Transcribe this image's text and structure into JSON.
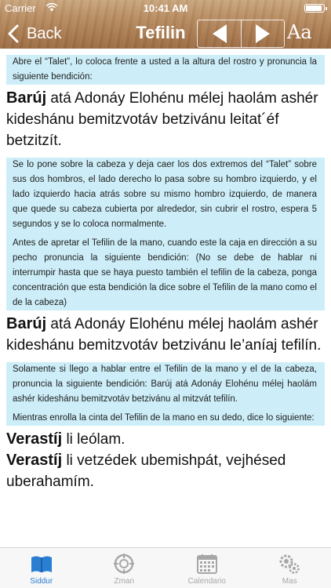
{
  "status": {
    "carrier": "Carrier",
    "time": "10:41 AM"
  },
  "nav": {
    "back_label": "Back",
    "title": "Tefilin",
    "font_button": "Aa"
  },
  "content": {
    "para1": "Abre el “Talet”, lo coloca frente a usted a la altura del rostro y pronuncia la siguiente bendición:",
    "prayer1_first": "Barúj",
    "prayer1_rest": " atá Adonáy Elohénu mélej haolám ashér kideshánu bemitzvotáv betzivánu leitat´éf betzitzít.",
    "para2": "Se lo pone sobre la cabeza y deja caer los dos extremos del “Talet” sobre sus dos hombros, el lado derecho lo pasa sobre su hombro izquierdo, y el lado izquierdo hacia atrás sobre su mismo hombro izquierdo, de manera que quede su cabeza cubierta por alrededor, sin cubrir el rostro, espera 5 segundos y se lo coloca normalmente.",
    "para3": "Antes de apretar el Tefilin de la mano, cuando este la caja en dirección a su pecho pronuncia la siguiente bendición: (No se debe de hablar ni interrumpir hasta que se haya puesto también el tefilin de la cabeza, ponga concentración que esta bendición la dice sobre el Tefilin de la mano como el de la cabeza)",
    "prayer2_first": "Barúj",
    "prayer2_rest": " atá Adonáy Elohénu mélej haolám ashér kideshánu bemitzvotáv betzivánu le’aníaj tefilín.",
    "para4": "Solamente si llego a hablar entre el Tefilin de la mano y el de la cabeza, pronuncia la siguiente bendición: Barúj atá Adonáy Elohénu mélej haolám ashér kideshánu bemitzvotáv betzivánu al mitzvát tefilín.",
    "para5": "Mientras enrolla la cinta del Tefilin de la mano en su dedo, dice lo siguiente:",
    "prayer3_first": "Verastíj",
    "prayer3_rest": " li leólam.",
    "prayer4_first": "Verastíj",
    "prayer4_rest": " li vetzédek ubemishpát, vejhésed uberahamím."
  },
  "tabs": [
    {
      "label": "Siddur",
      "icon": "book-icon",
      "active": true
    },
    {
      "label": "Zman",
      "icon": "compass-icon",
      "active": false
    },
    {
      "label": "Calendario",
      "icon": "calendar-icon",
      "active": false
    },
    {
      "label": "Mas",
      "icon": "gears-icon",
      "active": false
    }
  ],
  "colors": {
    "wood": "#a97a4f",
    "highlight": "#cdeef8",
    "tab_active": "#2a7fd2",
    "tab_inactive": "#a7a7a7"
  }
}
